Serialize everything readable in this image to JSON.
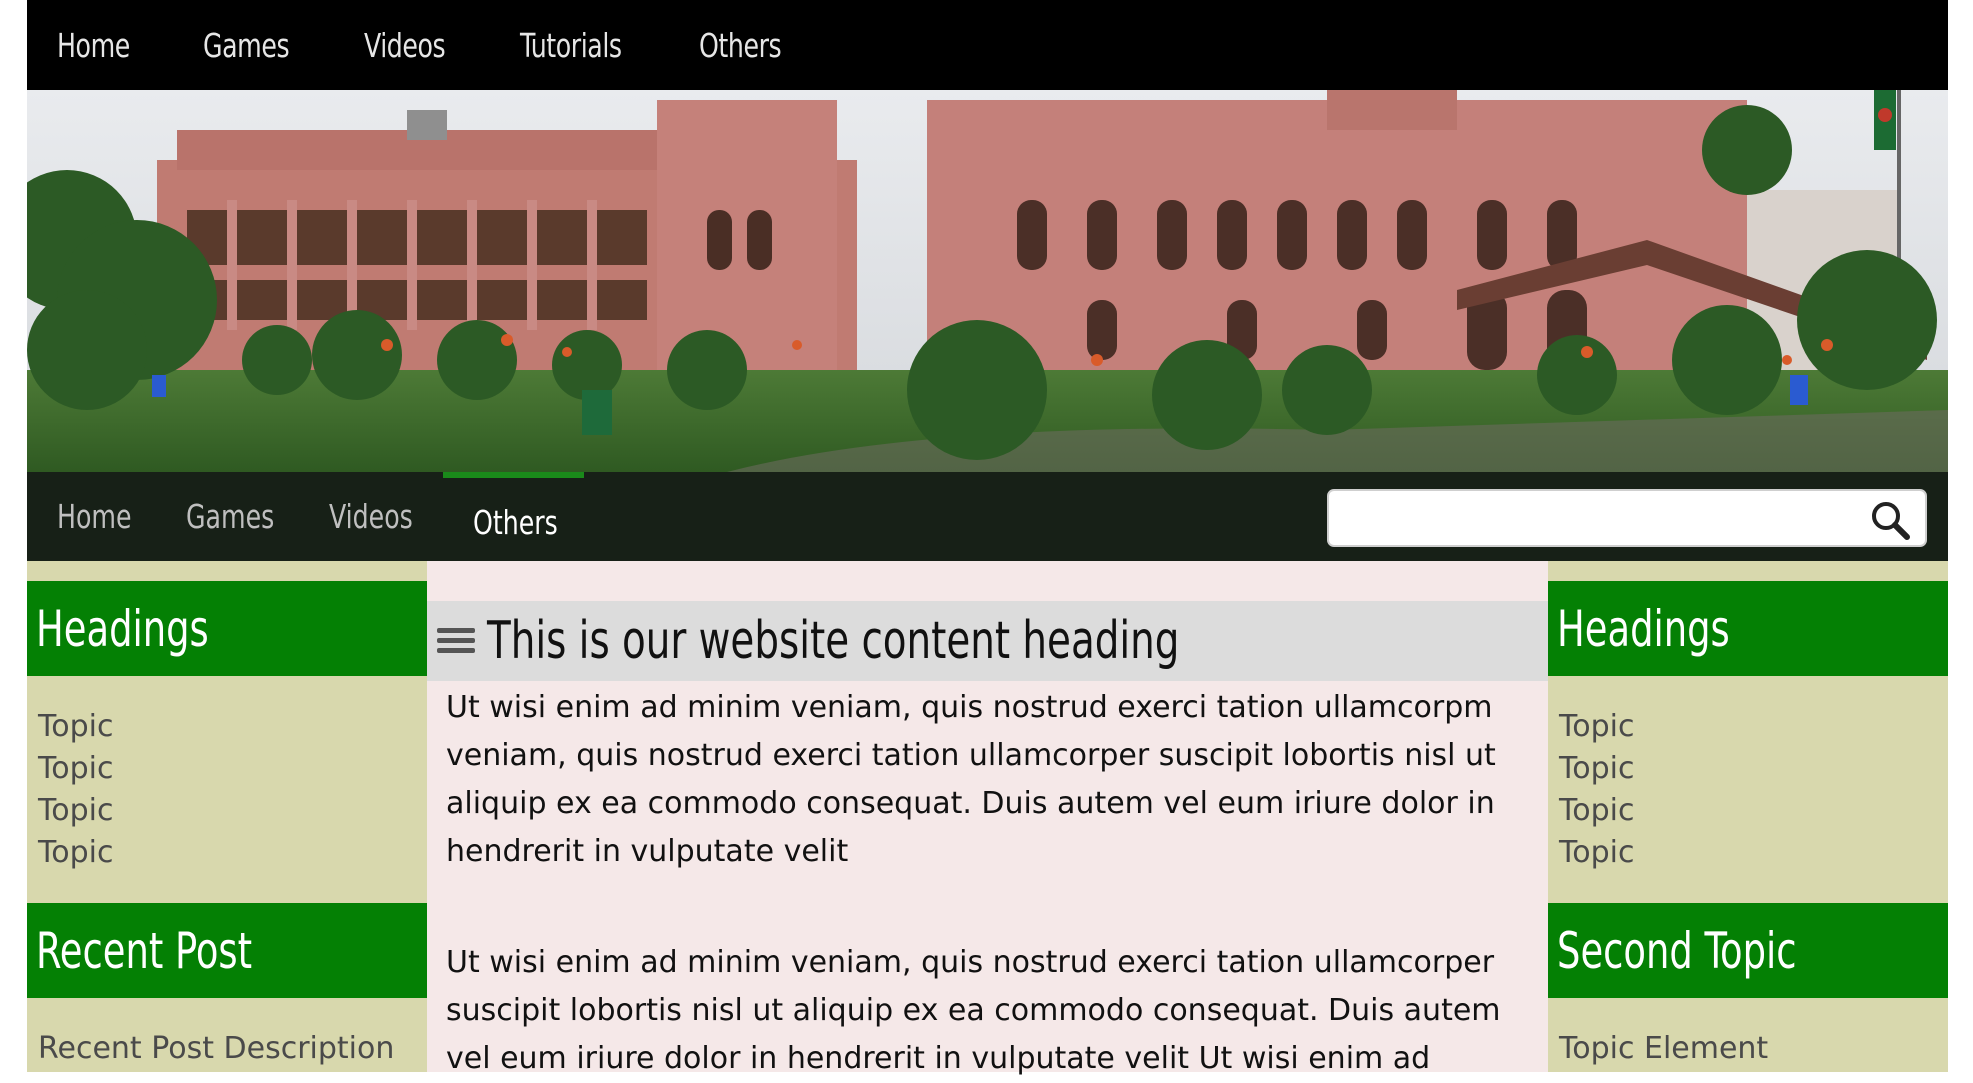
{
  "top_nav": {
    "items": [
      "Home",
      "Games",
      "Videos",
      "Tutorials",
      "Others"
    ]
  },
  "sub_nav": {
    "items": [
      "Home",
      "Games",
      "Videos",
      "Others"
    ],
    "active": "Others",
    "search_placeholder": ""
  },
  "left_sidebar": {
    "headings_title": "Headings",
    "topics": [
      "Topic",
      "Topic",
      "Topic",
      "Topic"
    ],
    "recent_title": "Recent Post",
    "recent_item": "Recent Post Description"
  },
  "right_sidebar": {
    "headings_title": "Headings",
    "topics": [
      "Topic",
      "Topic",
      "Topic",
      "Topic"
    ],
    "second_title": "Second Topic",
    "second_item": "Topic Element"
  },
  "content": {
    "heading": "This is our website content heading",
    "paragraph1": "Ut wisi enim ad minim veniam, quis nostrud exerci tation ullamcorpm veniam, quis nostrud exerci tation ullamcorper suscipit lobortis nisl ut aliquip ex ea commodo consequat. Duis autem vel eum iriure dolor in hendrerit in vulputate velit",
    "paragraph2": "Ut wisi enim ad minim veniam, quis nostrud exerci tation ullamcorper suscipit lobortis nisl ut aliquip ex ea commodo consequat. Duis autem vel eum iriure dolor in hendrerit in vulputate velit Ut wisi enim ad"
  },
  "colors": {
    "nav_bg": "#000000",
    "accent_green": "#048004",
    "sidebar_bg": "#d8d8ad",
    "content_bg": "#f5e8e8",
    "building": "#c98a84"
  },
  "icons": {
    "search": "search-icon",
    "menu": "hamburger-icon",
    "banner": "palace-banner-image"
  }
}
